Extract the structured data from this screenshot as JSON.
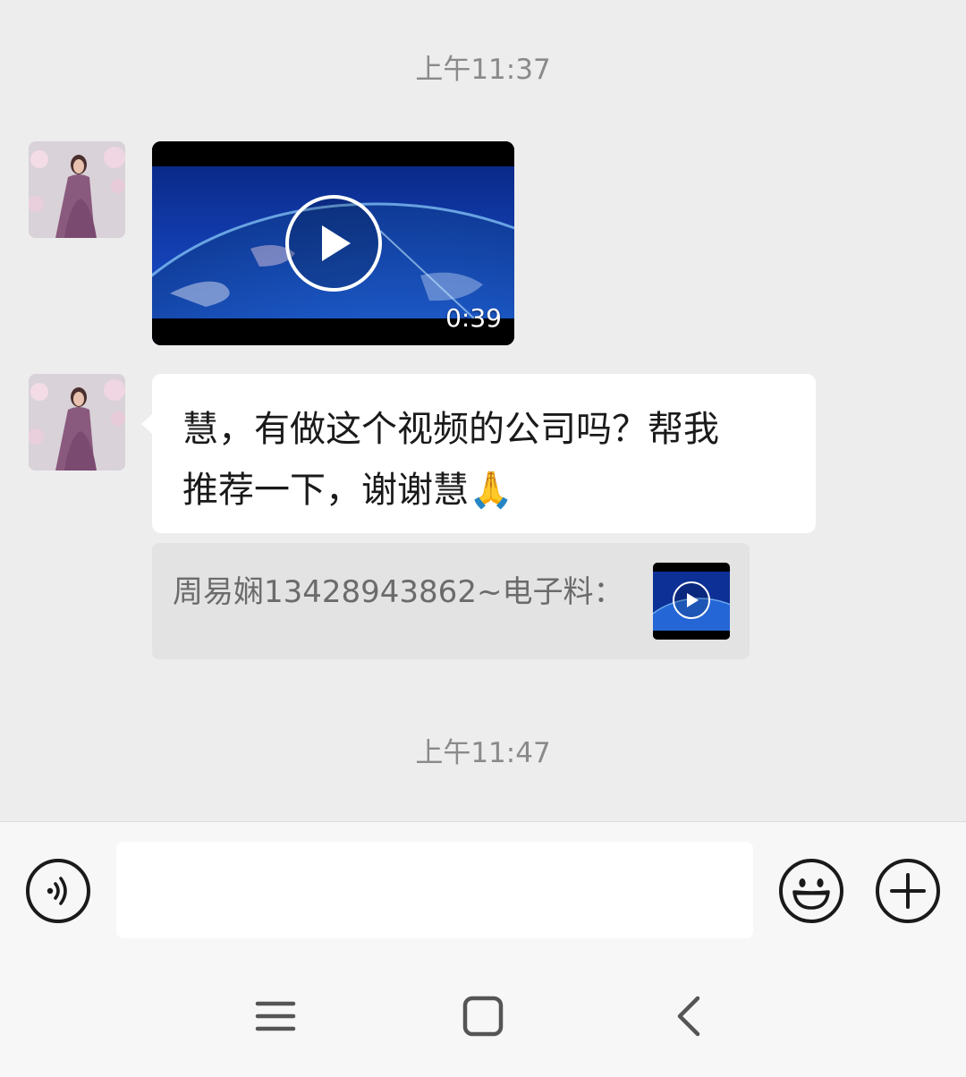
{
  "messages": {
    "timestamp_1": "上午11:37",
    "timestamp_2": "上午11:47",
    "video": {
      "duration": "0:39"
    },
    "text_message": {
      "line_1": "慧，有做这个视频的公司吗？帮我",
      "line_2": "推荐一下，谢谢慧🙏"
    },
    "quote": {
      "text": "周易娴13428943862~电子料："
    }
  },
  "input_bar": {
    "value": "",
    "voice_icon": "voice-icon",
    "emoji_icon": "emoji-icon",
    "plus_icon": "plus-icon"
  },
  "nav_bar": {
    "menu_icon": "menu-icon",
    "home_icon": "home-icon",
    "back_icon": "back-icon"
  },
  "colors": {
    "background": "#ededed",
    "bubble": "#ffffff",
    "quote_bg": "#e3e3e3",
    "timestamp": "#8a8a8a"
  }
}
